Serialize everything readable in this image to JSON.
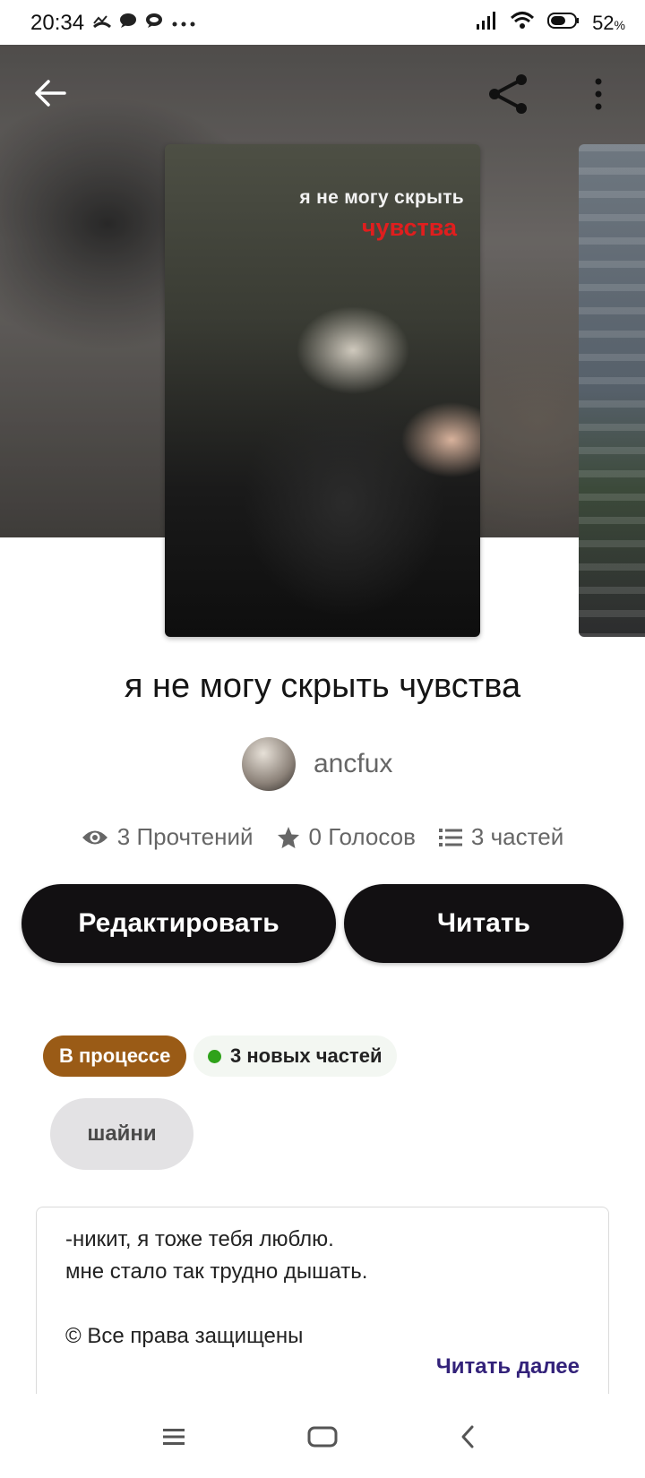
{
  "status_bar": {
    "time": "20:34",
    "notification_icons": [
      "call-missed-icon",
      "chat-bubble-icon",
      "chat-bubbles-icon",
      "more-dots-icon"
    ],
    "battery_percent": "52",
    "battery_unit": "%"
  },
  "header": {
    "back_icon": "arrow-left-icon",
    "share_icon": "share-icon",
    "more_icon": "more-vertical-icon"
  },
  "cover": {
    "line1": "я не могу скрыть",
    "line2": "чувства",
    "line2_color": "#e01e1e"
  },
  "story": {
    "title": "я не могу скрыть чувства",
    "author": "ancfux"
  },
  "stats": {
    "reads": "3 Прочтений",
    "votes": "0 Голосов",
    "parts": "3 частей"
  },
  "actions": {
    "edit_label": "Редактировать",
    "read_label": "Читать"
  },
  "badges": {
    "status": "В процессе",
    "status_color": "#9a5b16",
    "new_parts": "3 новых частей",
    "new_dot_color": "#2fa21a"
  },
  "tags": [
    "шайни"
  ],
  "description": {
    "lines": [
      "-никит, я тоже тебя люблю.",
      "мне стало так трудно дышать.",
      "",
      "© Все права защищены"
    ],
    "read_more": "Читать далее",
    "read_more_color": "#33227a"
  },
  "navbar": {
    "items": [
      "menu-icon",
      "home-icon",
      "back-icon"
    ]
  }
}
